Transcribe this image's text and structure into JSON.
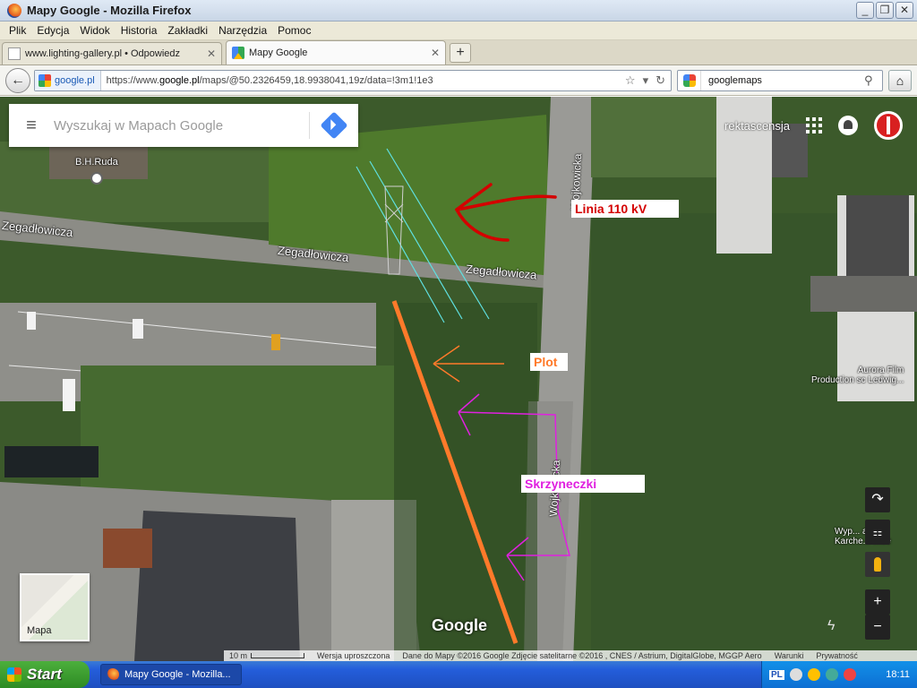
{
  "window": {
    "title": "Mapy Google - Mozilla Firefox",
    "controls": [
      "_",
      "❐",
      "✕"
    ]
  },
  "menu": [
    "Plik",
    "Edycja",
    "Widok",
    "Historia",
    "Zakładki",
    "Narzędzia",
    "Pomoc"
  ],
  "tabs": [
    {
      "label": "www.lighting-gallery.pl • Odpowiedz",
      "active": false
    },
    {
      "label": "Mapy Google",
      "active": true
    }
  ],
  "newtab_label": "+",
  "nav": {
    "back": "←",
    "identity": "google.pl",
    "url_prefix": "https://www.",
    "url_host": "google.pl",
    "url_rest": "/maps/@50.2326459,18.9938041,19z/data=!3m1!1e3",
    "bookmark_star": "☆",
    "dropdown": "▾",
    "reload": "↻",
    "search_text": "googlemaps",
    "search_icon": "⚲",
    "home": "⌂"
  },
  "map": {
    "search": {
      "placeholder": "Wyszukaj w Mapach Google",
      "menu_icon": "≡"
    },
    "labels": {
      "bh_ruda": "B.H.Ruda",
      "street_zeg1": "Zegadłowicza",
      "street_zeg2": "Zegadłowicza",
      "street_zeg3": "Zegadłowicza",
      "street_wo1": "Wojkowicka",
      "street_wo2": "Wojkowicka",
      "aurora": "Aurora Film\nProduction sc Ledwig...",
      "wyp": "Wyp... alnia\nKarche... wice"
    },
    "overlays": {
      "linia": "Linia 110 kV",
      "plot": "Plot",
      "skrzyneczki": "Skrzyneczki"
    },
    "overlay_colors": {
      "linia": "#d40000",
      "plot": "#ff7a2a",
      "skrzyneczki": "#e020e0"
    },
    "top_right_link": "rektascensja",
    "minimap_label": "Mapa",
    "controls": {
      "rotate": "↷",
      "zoom_in": "+",
      "zoom_out": "−"
    },
    "google_logo": "Google",
    "attribution": {
      "scale": "10 m",
      "mode": "Wersja uproszczona",
      "data": "Dane do Mapy ©2016 Google Zdjęcie satelitarne ©2016 , CNES / Astrium, DigitalGlobe, MGGP Aero",
      "terms": "Warunki",
      "privacy": "Prywatność"
    }
  },
  "taskbar": {
    "start": "Start",
    "item": "Mapy Google - Mozilla...",
    "lang": "PL",
    "clock": "18:11"
  }
}
